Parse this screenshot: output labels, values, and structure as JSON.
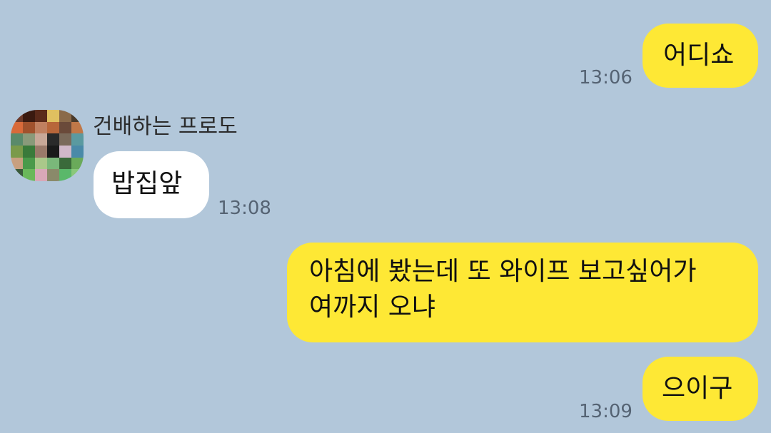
{
  "messages": [
    {
      "id": "m1",
      "side": "me",
      "text": "어디쇼",
      "time": "13:06"
    },
    {
      "id": "m2",
      "side": "other",
      "sender": "건배하는 프로도",
      "text": "밥집앞",
      "time": "13:08"
    },
    {
      "id": "m3",
      "side": "me",
      "lines": [
        "아침에 봤는데 또 와이프 보고싶어가",
        "여까지 오냐"
      ]
    },
    {
      "id": "m4",
      "side": "me",
      "text": "으이구",
      "time": "13:09"
    }
  ],
  "colors": {
    "background": "#b2c7da",
    "my_bubble": "#fee835",
    "other_bubble": "#ffffff",
    "timestamp": "#556373"
  },
  "avatar": {
    "icon": "pixelated-profile-avatar",
    "mosaic_colors": [
      "#6b3a2a",
      "#3a1a10",
      "#5a2a1a",
      "#e0c060",
      "#8a6a4a",
      "#4a3a2a",
      "#d86a3a",
      "#a0522d",
      "#c08060",
      "#b8663a",
      "#6a4a3a",
      "#c07848",
      "#5a8a6a",
      "#8a9a7a",
      "#c8a898",
      "#2a2a2a",
      "#7a6a5a",
      "#5a9aa0",
      "#7a9a4a",
      "#3a7a3a",
      "#9a7a6a",
      "#1a1a1a",
      "#d0b8c8",
      "#4a8aa8",
      "#c8a080",
      "#4a9a4a",
      "#aac88a",
      "#7ab87a",
      "#3a6a3a",
      "#6aaa5a",
      "#3a5a3a",
      "#6ab85a",
      "#d8a8b8",
      "#8a8a6a",
      "#5ab86a",
      "#8ac87a"
    ]
  }
}
